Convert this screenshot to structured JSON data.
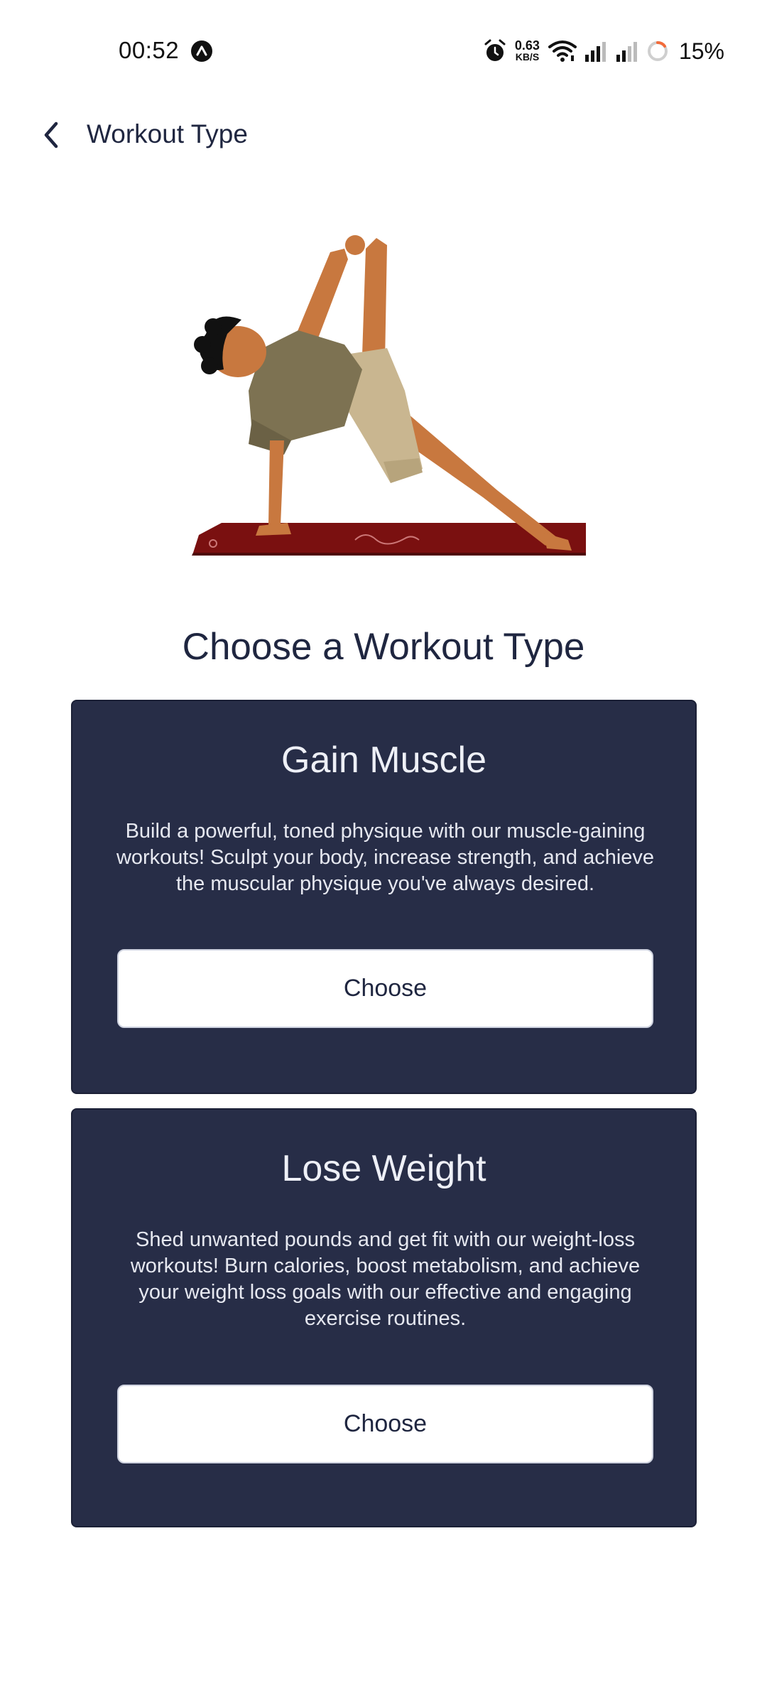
{
  "status_bar": {
    "time": "00:52",
    "app_icon": "a-badge-icon",
    "net_speed_value": "0.63",
    "net_speed_unit": "KB/S",
    "battery_percent": "15%"
  },
  "header": {
    "back_icon": "chevron-left-icon",
    "title": "Workout Type"
  },
  "illustration": "yoga-pose-illustration",
  "page_title": "Choose a Workout Type",
  "cards": [
    {
      "title": "Gain Muscle",
      "description": "Build a powerful, toned physique with our muscle-gaining workouts! Sculpt your body, increase strength, and achieve the muscular physique you've always desired.",
      "button_label": "Choose"
    },
    {
      "title": "Lose Weight",
      "description": "Shed unwanted pounds and get fit with our weight-loss workouts! Burn calories, boost metabolism, and achieve your weight loss goals with our effective and engaging exercise routines.",
      "button_label": "Choose"
    }
  ],
  "colors": {
    "card_bg": "#272d47",
    "text_primary": "#1f2640",
    "mat": "#7a1010"
  }
}
